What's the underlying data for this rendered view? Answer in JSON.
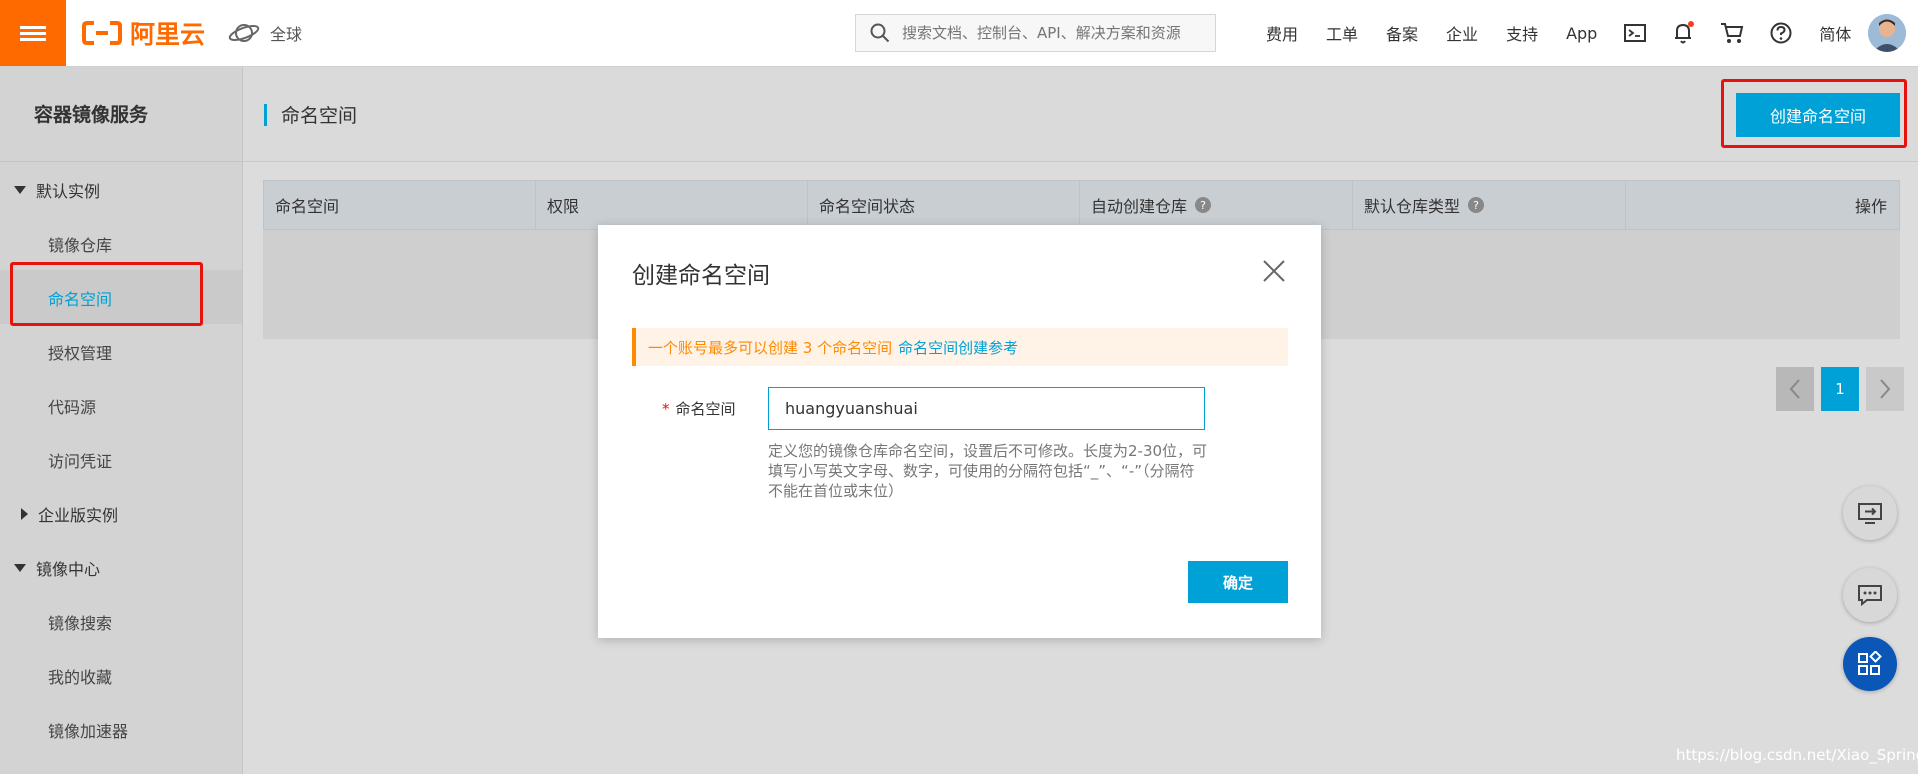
{
  "topbar": {
    "brand": "阿里云",
    "region": "全球",
    "search_placeholder": "搜索文档、控制台、API、解决方案和资源",
    "nav": [
      "费用",
      "工单",
      "备案",
      "企业",
      "支持",
      "App"
    ],
    "language": "简体",
    "icons": [
      "terminal-icon",
      "bell-icon",
      "cart-icon",
      "help-icon"
    ]
  },
  "sidebar": {
    "title": "容器镜像服务",
    "groups": [
      {
        "label": "默认实例",
        "expanded": true,
        "items": [
          "镜像仓库",
          "命名空间",
          "授权管理",
          "代码源",
          "访问凭证"
        ]
      },
      {
        "label": "企业版实例",
        "expanded": false,
        "items": []
      },
      {
        "label": "镜像中心",
        "expanded": true,
        "items": [
          "镜像搜索",
          "我的收藏",
          "镜像加速器"
        ]
      }
    ],
    "active_item": "命名空间"
  },
  "main": {
    "title": "命名空间",
    "create_button": "创建命名空间",
    "columns": [
      "命名空间",
      "权限",
      "命名空间状态",
      "自动创建仓库",
      "默认仓库类型",
      "操作"
    ],
    "pager": {
      "current": "1"
    }
  },
  "modal": {
    "title": "创建命名空间",
    "notice_text": "一个账号最多可以创建 3 个命名空间",
    "notice_link": "命名空间创建参考",
    "field_label": "命名空间",
    "field_value": "huangyuanshuai",
    "help_text": "定义您的镜像仓库命名空间，设置后不可修改。长度为2-30位，可填写小写英文字母、数字，可使用的分隔符包括“_”、“-”（分隔符不能在首位或末位）",
    "ok_button": "确定"
  },
  "watermark": "https://blog.csdn.net/Xiao_Spring",
  "colors": {
    "brand": "#ff6a00",
    "accent": "#00a1d6",
    "highlight": "#e8120c"
  }
}
